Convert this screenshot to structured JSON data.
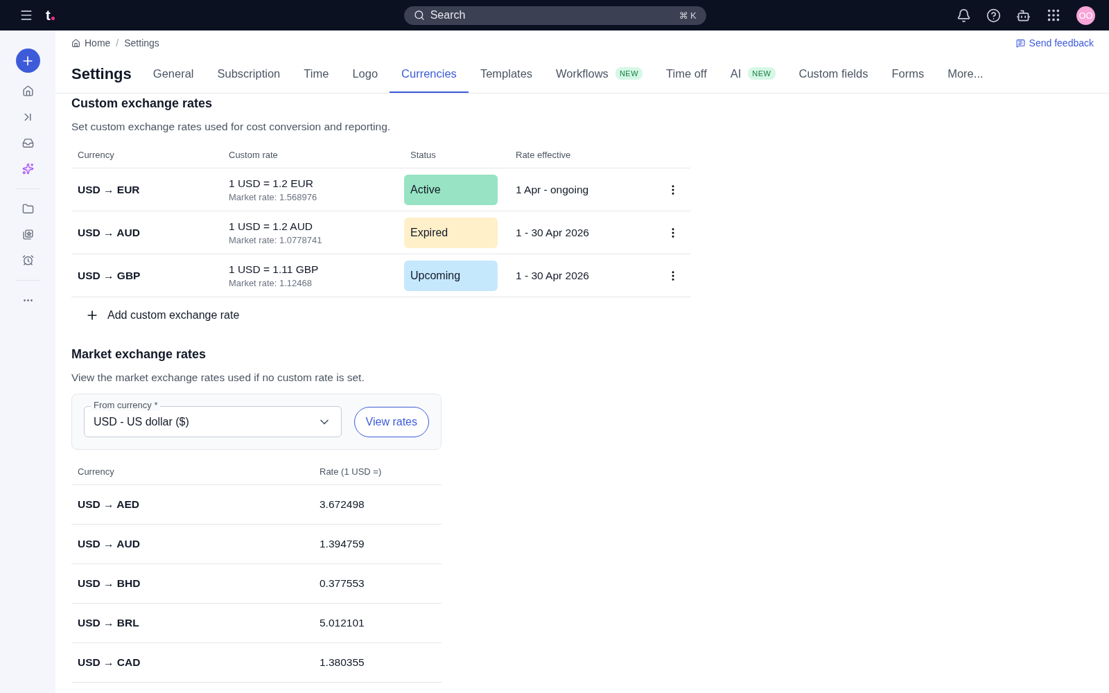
{
  "topbar": {
    "logo": "t",
    "search": {
      "placeholder": "Search",
      "shortcut": "⌘ K"
    },
    "avatar": "OO"
  },
  "breadcrumb": [
    "Home",
    "Settings"
  ],
  "breadcrumb_separator": "/",
  "feedback": "Send feedback",
  "page_title": "Settings",
  "tabs": [
    {
      "label": "General",
      "selected": false
    },
    {
      "label": "Subscription",
      "selected": false
    },
    {
      "label": "Time",
      "selected": false
    },
    {
      "label": "Logo",
      "selected": false
    },
    {
      "label": "Currencies",
      "selected": true
    },
    {
      "label": "Templates",
      "selected": false
    },
    {
      "label": "Workflows",
      "badge": "NEW",
      "selected": false
    },
    {
      "label": "Time off",
      "selected": false
    },
    {
      "label": "AI",
      "badge": "NEW",
      "selected": false
    },
    {
      "label": "Custom fields",
      "selected": false
    },
    {
      "label": "Forms",
      "selected": false
    },
    {
      "label": "More...",
      "selected": false
    }
  ],
  "custom": {
    "title": "Custom exchange rates",
    "description": "Set custom exchange rates used for cost conversion and reporting.",
    "columns": [
      "Currency",
      "Custom rate",
      "Status",
      "Rate effective"
    ],
    "rows": [
      {
        "currency": "USD → EUR",
        "rate": "1 USD = 1.2 EUR",
        "market": "Market rate: 1.568976",
        "status": "Active",
        "color": "#97e3c3",
        "effective": "1 Apr - ongoing"
      },
      {
        "currency": "USD → AUD",
        "rate": "1 USD = 1.2 AUD",
        "market": "Market rate: 1.0778741",
        "status": "Expired",
        "color": "#fff0c9",
        "effective": "1 - 30 Apr 2026"
      },
      {
        "currency": "USD → GBP",
        "rate": "1 USD = 1.11 GBP",
        "market": "Market rate: 1.12468",
        "status": "Upcoming",
        "color": "#c5e8fd",
        "effective": "1 - 30 Apr 2026"
      }
    ],
    "add": "Add custom exchange rate"
  },
  "market": {
    "title": "Market exchange rates",
    "description": "View the market exchange rates used if no custom rate is set.",
    "field": {
      "label": "From currency *",
      "value": "USD - US dollar ($)"
    },
    "button": "View rates",
    "columns": [
      "Currency",
      "Rate (1 USD =)"
    ],
    "rows": [
      {
        "currency": "USD → AED",
        "rate": "3.672498"
      },
      {
        "currency": "USD → AUD",
        "rate": "1.394759"
      },
      {
        "currency": "USD → BHD",
        "rate": "0.377553"
      },
      {
        "currency": "USD → BRL",
        "rate": "5.012101"
      },
      {
        "currency": "USD → CAD",
        "rate": "1.380355"
      }
    ]
  }
}
